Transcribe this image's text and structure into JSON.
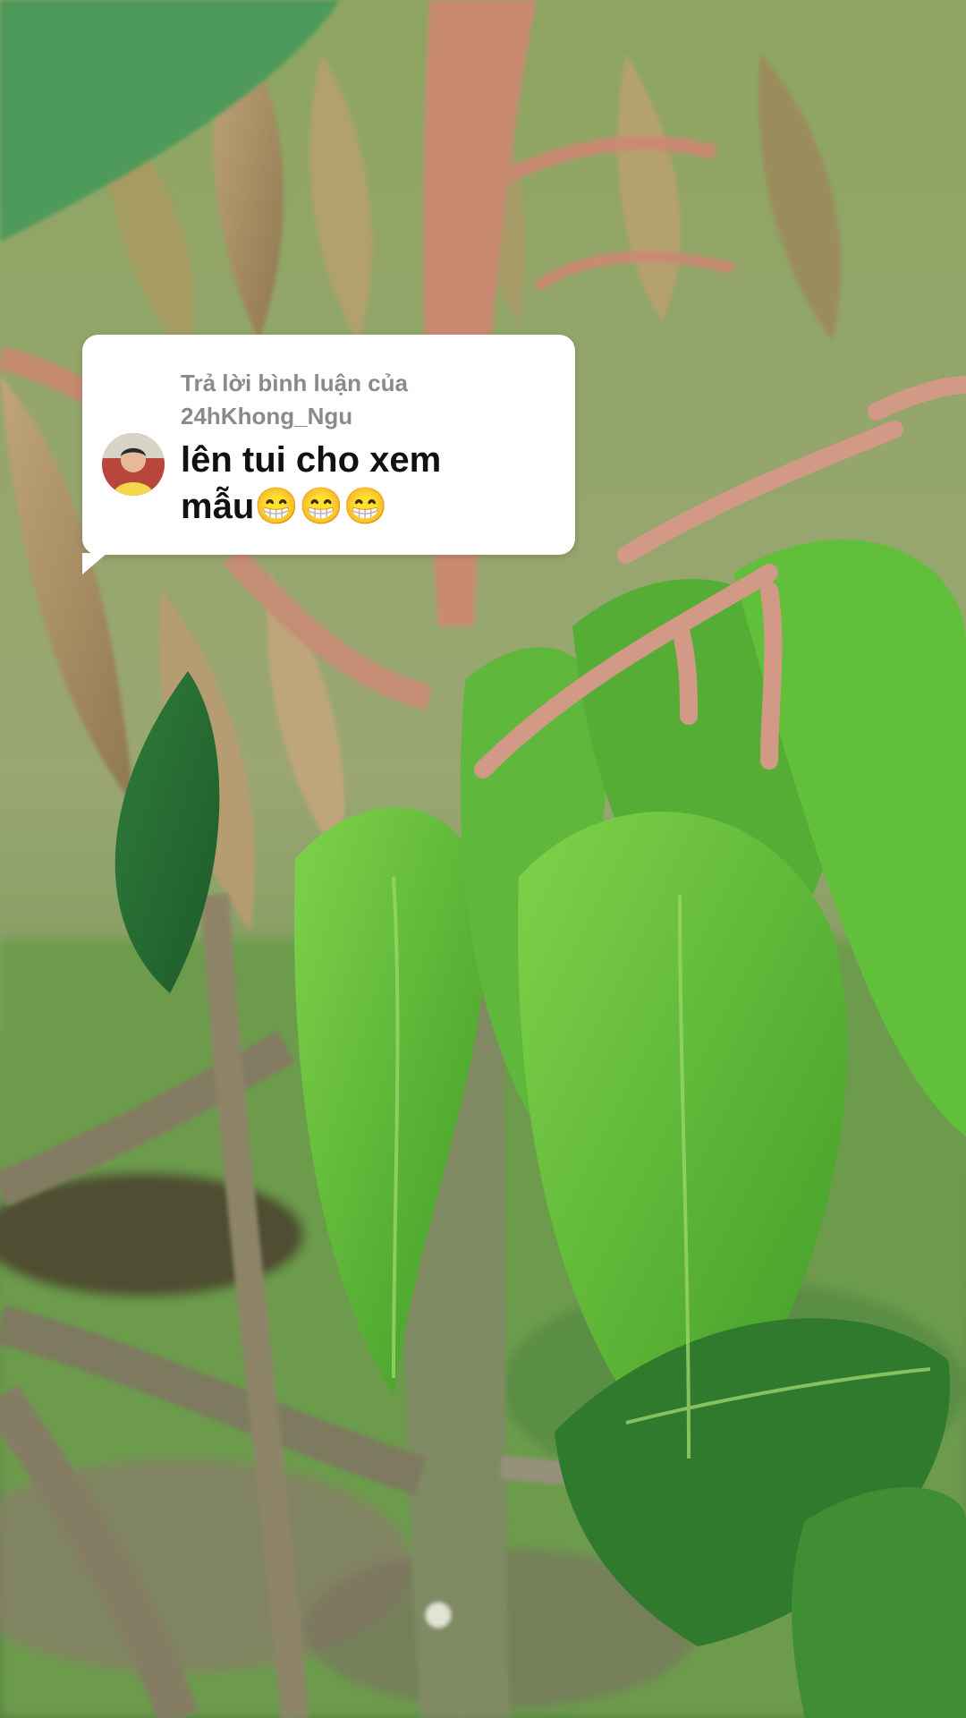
{
  "reply": {
    "header_line1": "Trả lời bình luận của",
    "header_line2": "24hKhong_Ngu",
    "comment_line1": "lên tui cho xem",
    "comment_line2": "mẫu😁😁😁",
    "avatar_icon": "user-avatar-icon"
  },
  "colors": {
    "bubble_bg": "#ffffff",
    "header_text": "#8a8a8a",
    "comment_text": "#111111"
  }
}
